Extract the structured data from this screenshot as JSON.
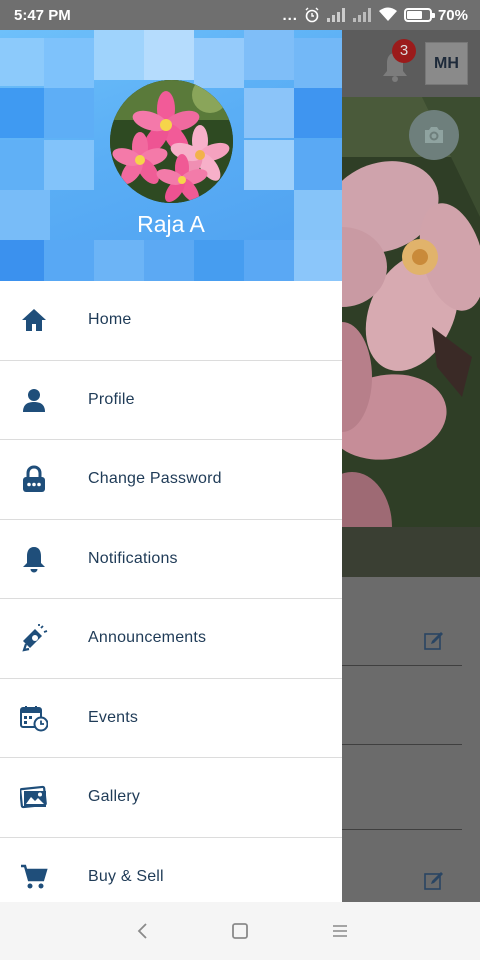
{
  "status_bar": {
    "time": "5:47 PM",
    "dots": "...",
    "battery_percent": "70%",
    "battery_level": 0.7,
    "icons": [
      "alarm-icon",
      "signal-icon",
      "signal-icon",
      "wifi-icon",
      "battery-icon"
    ]
  },
  "app": {
    "notification_count": "3",
    "user_initials": "MH"
  },
  "drawer": {
    "user_name": "Raja A",
    "menu": [
      {
        "label": "Home",
        "icon": "home-icon"
      },
      {
        "label": "Profile",
        "icon": "person-icon"
      },
      {
        "label": "Change Password",
        "icon": "lock-icon"
      },
      {
        "label": "Notifications",
        "icon": "bell-icon"
      },
      {
        "label": "Announcements",
        "icon": "megaphone-icon"
      },
      {
        "label": "Events",
        "icon": "calendar-clock-icon"
      },
      {
        "label": "Gallery",
        "icon": "gallery-icon"
      },
      {
        "label": "Buy & Sell",
        "icon": "cart-icon"
      }
    ]
  },
  "nav_bar": {
    "buttons": [
      "back-icon",
      "home-square-icon",
      "menu-lines-icon"
    ]
  },
  "colors": {
    "menu_text": "#1f3b57",
    "menu_icon": "#1f4e7a",
    "header_blue": "#5aaef5",
    "badge_red": "#9b1b1b"
  }
}
